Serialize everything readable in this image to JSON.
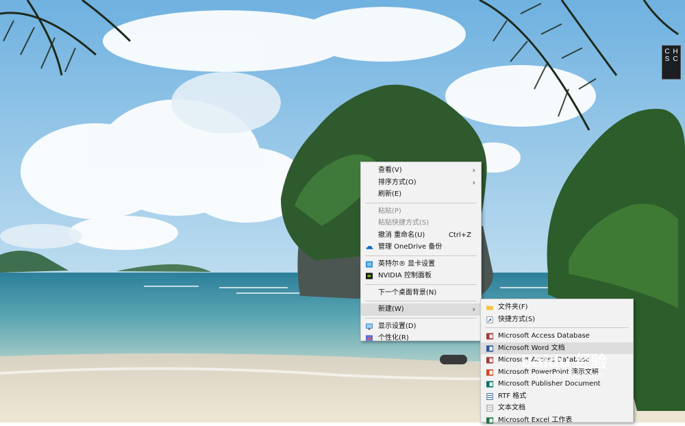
{
  "ime_indicator": {
    "chars": [
      "C",
      "H",
      "S",
      "C"
    ]
  },
  "context_menu": {
    "items": [
      {
        "label": "查看(V)",
        "submenu": true
      },
      {
        "label": "排序方式(O)",
        "submenu": true
      },
      {
        "label": "刷新(E)"
      },
      {
        "label": "粘贴(P)",
        "disabled": true
      },
      {
        "label": "粘贴快捷方式(S)",
        "disabled": true
      },
      {
        "label": "撤消 重命名(U)",
        "shortcut": "Ctrl+Z"
      },
      {
        "label": "管理 OneDrive 备份",
        "icon": "onedrive-icon"
      },
      {
        "label": "英特尔® 显卡设置",
        "icon": "intel-graphics-icon"
      },
      {
        "label": "NVIDIA 控制面板",
        "icon": "nvidia-icon"
      },
      {
        "label": "下一个桌面背景(N)"
      },
      {
        "label": "新建(W)",
        "submenu": true,
        "highlighted": true
      },
      {
        "label": "显示设置(D)",
        "icon": "display-icon"
      },
      {
        "label": "个性化(R)",
        "icon": "personalize-icon"
      }
    ]
  },
  "new_submenu": {
    "items": [
      {
        "label": "文件夹(F)",
        "icon": "folder-icon"
      },
      {
        "label": "快捷方式(S)",
        "icon": "shortcut-icon"
      },
      {
        "label": "Microsoft Access Database",
        "icon": "access-icon"
      },
      {
        "label": "Microsoft Word 文档",
        "icon": "word-icon",
        "highlighted": true
      },
      {
        "label": "Microsoft Access Database",
        "icon": "access-icon"
      },
      {
        "label": "Microsoft PowerPoint 演示文稿",
        "icon": "powerpoint-icon"
      },
      {
        "label": "Microsoft Publisher Document",
        "icon": "publisher-icon"
      },
      {
        "label": "RTF 格式",
        "icon": "rtf-icon"
      },
      {
        "label": "文本文档",
        "icon": "text-document-icon"
      },
      {
        "label": "Microsoft Excel 工作表",
        "icon": "excel-icon"
      }
    ]
  },
  "watermark": {
    "logo": "Baidu 经验",
    "url": "jingyan.baidu.com"
  },
  "colors": {
    "menu_bg": "#f2f2f2",
    "highlight": "#dcdcdc",
    "sky": "#8fc3e6",
    "sea": "#3f8fa3"
  }
}
